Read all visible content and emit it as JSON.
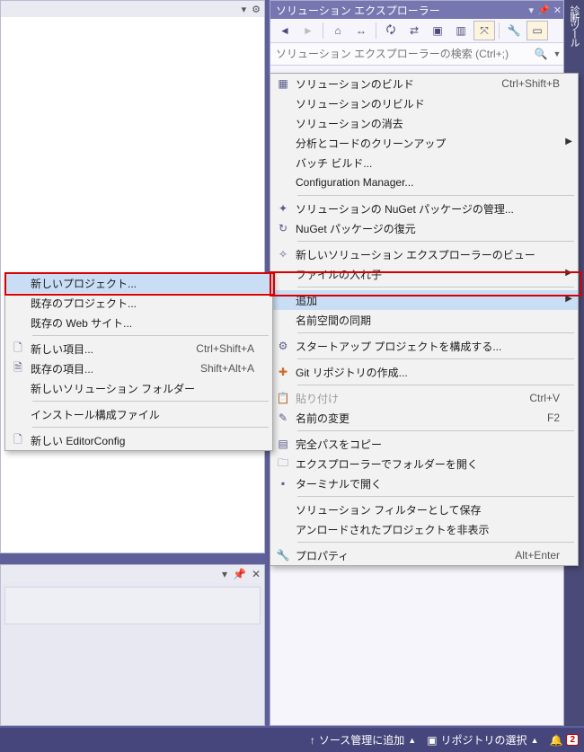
{
  "solutionExplorer": {
    "title": "ソリューション エクスプローラー",
    "searchPlaceholder": "ソリューション エクスプローラーの検索 (Ctrl+;)"
  },
  "toolsTab": "診断ツール",
  "mainMenu": {
    "build": {
      "label": "ソリューションのビルド",
      "shortcut": "Ctrl+Shift+B"
    },
    "rebuild": {
      "label": "ソリューションのリビルド"
    },
    "clean": {
      "label": "ソリューションの消去"
    },
    "analyze": {
      "label": "分析とコードのクリーンアップ"
    },
    "batchBuild": {
      "label": "バッチ ビルド..."
    },
    "configMgr": {
      "label": "Configuration Manager..."
    },
    "nugetManage": {
      "label": "ソリューションの NuGet パッケージの管理..."
    },
    "nugetRestore": {
      "label": "NuGet パッケージの復元"
    },
    "newView": {
      "label": "新しいソリューション エクスプローラーのビュー"
    },
    "fileNesting": {
      "label": "ファイルの入れ子"
    },
    "add": {
      "label": "追加"
    },
    "syncNamespace": {
      "label": "名前空間の同期"
    },
    "startupProj": {
      "label": "スタートアップ プロジェクトを構成する..."
    },
    "gitRepo": {
      "label": "Git リポジトリの作成..."
    },
    "paste": {
      "label": "貼り付け",
      "shortcut": "Ctrl+V"
    },
    "rename": {
      "label": "名前の変更",
      "shortcut": "F2"
    },
    "copyFullPath": {
      "label": "完全パスをコピー"
    },
    "openInExplorer": {
      "label": "エクスプローラーでフォルダーを開く"
    },
    "openInTerminal": {
      "label": "ターミナルで開く"
    },
    "saveAsFilter": {
      "label": "ソリューション フィルターとして保存"
    },
    "hideUnloaded": {
      "label": "アンロードされたプロジェクトを非表示"
    },
    "properties": {
      "label": "プロパティ",
      "shortcut": "Alt+Enter"
    }
  },
  "addSubmenu": {
    "newProject": {
      "label": "新しいプロジェクト..."
    },
    "existingProject": {
      "label": "既存のプロジェクト..."
    },
    "existingWebsite": {
      "label": "既存の Web サイト..."
    },
    "newItem": {
      "label": "新しい項目...",
      "shortcut": "Ctrl+Shift+A"
    },
    "existingItem": {
      "label": "既存の項目...",
      "shortcut": "Shift+Alt+A"
    },
    "newSlnFolder": {
      "label": "新しいソリューション フォルダー"
    },
    "installConfig": {
      "label": "インストール構成ファイル"
    },
    "newEditorConfig": {
      "label": "新しい EditorConfig"
    }
  },
  "statusbar": {
    "addSourceControl": "ソース管理に追加",
    "selectRepo": "リポジトリの選択",
    "notifications": "2"
  }
}
